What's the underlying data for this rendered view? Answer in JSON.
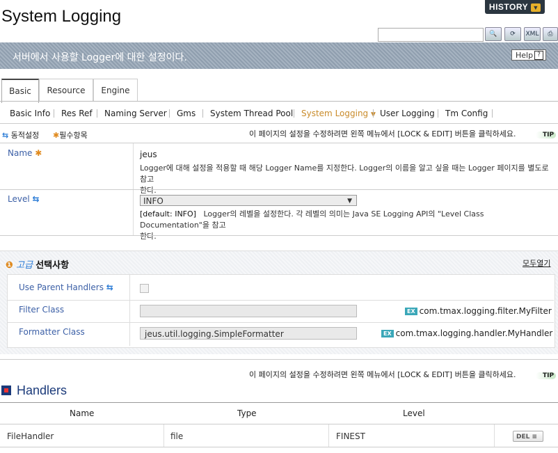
{
  "header": {
    "title": "System Logging",
    "history_label": "HISTORY",
    "search_placeholder": "",
    "tools": [
      {
        "icon": "search-icon"
      },
      {
        "icon": "refresh-icon"
      },
      {
        "icon": "xml-icon",
        "label": "XML"
      },
      {
        "icon": "print-icon"
      }
    ]
  },
  "banner": {
    "text": "서버에서 사용할 Logger에 대한 설정이다.",
    "help_label": "Help",
    "help_mark": "?"
  },
  "main_tabs": [
    {
      "label": "Basic",
      "active": true
    },
    {
      "label": "Resource",
      "active": false
    },
    {
      "label": "Engine",
      "active": false
    }
  ],
  "sub_tabs": [
    {
      "label": "Basic Info"
    },
    {
      "label": "Res Ref"
    },
    {
      "label": "Naming Server"
    },
    {
      "label": "Gms"
    },
    {
      "label": "System Thread Pool"
    },
    {
      "label": "System Logging",
      "active": true
    },
    {
      "label": "User Logging"
    },
    {
      "label": "Tm Config"
    }
  ],
  "legend": {
    "dynamic_label": "동적설정",
    "required_label": "필수항목",
    "tip_text": "이 페이지의 설정을 수정하려면 왼쪽 메뉴에서 [LOCK & EDIT] 버튼을 클릭하세요.",
    "tip_badge": "TIP"
  },
  "fields": {
    "name": {
      "label": "Name",
      "value": "jeus",
      "desc_1": "Logger에 대해 설정을 적용할 때 해당 Logger Name를 지정한다. Logger의 이름을 알고 싶을 때는 Logger 페이지를 별도로 참고",
      "desc_2": "한다."
    },
    "level": {
      "label": "Level",
      "selected": "INFO",
      "default": "[default: INFO]",
      "desc_1": "Logger의 레벨을 설정한다. 각 레벨의 의미는 Java SE Logging API의 \"Level Class Documentation\"을 참고",
      "desc_2": "한다."
    }
  },
  "advanced": {
    "title_prefix": "고급",
    "title": "선택사항",
    "expand_all": "모두열기",
    "use_parent_handlers": {
      "label": "Use Parent Handlers",
      "checked": false
    },
    "filter_class": {
      "label": "Filter Class",
      "value": "",
      "example": "com.tmax.logging.filter.MyFilter",
      "ex_badge": "EX"
    },
    "formatter_class": {
      "label": "Formatter Class",
      "value": "jeus.util.logging.SimpleFormatter",
      "example": "com.tmax.logging.handler.MyHandler",
      "ex_badge": "EX"
    }
  },
  "handlers": {
    "tip_text": "이 페이지의 설정을 수정하려면 왼쪽 메뉴에서 [LOCK & EDIT] 버튼을 클릭하세요.",
    "tip_badge": "TIP",
    "title": "Handlers",
    "columns": [
      "Name",
      "Type",
      "Level"
    ],
    "rows": [
      {
        "name": "FileHandler",
        "type": "file",
        "level": "FINEST",
        "del_label": "DEL"
      }
    ]
  }
}
